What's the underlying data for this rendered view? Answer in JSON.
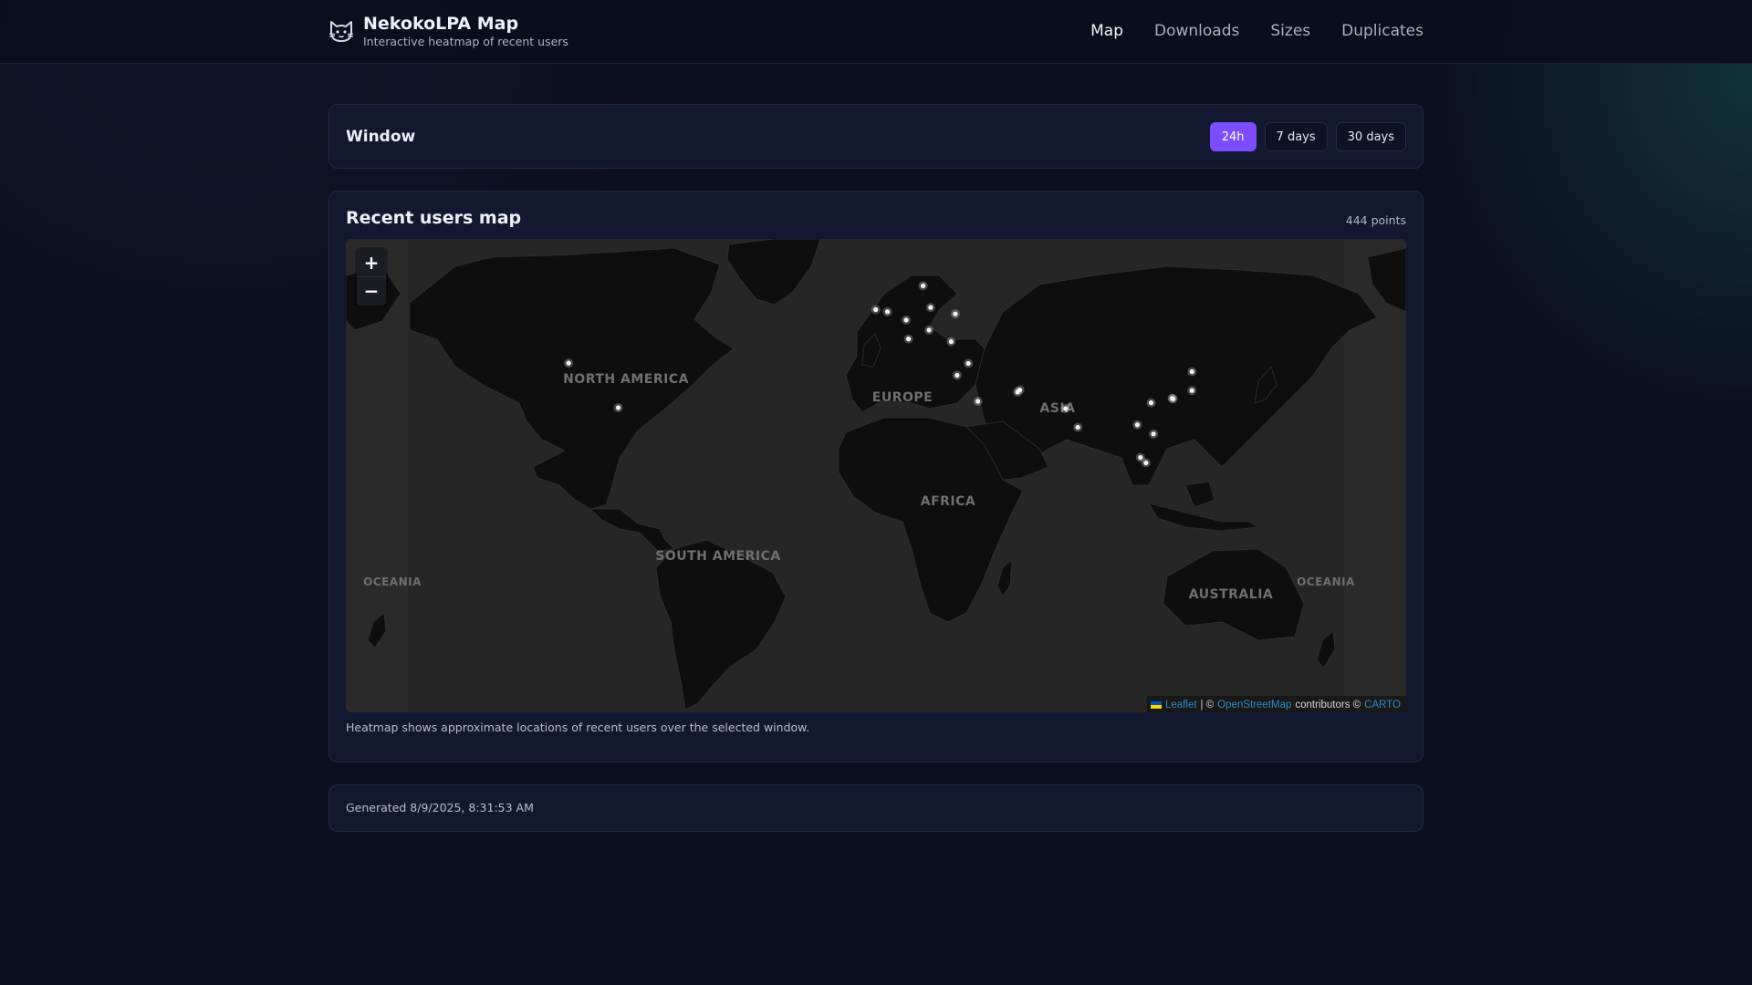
{
  "header": {
    "title": "NekokoLPA Map",
    "subtitle": "Interactive heatmap of recent users",
    "nav": [
      {
        "label": "Map",
        "active": true
      },
      {
        "label": "Downloads",
        "active": false
      },
      {
        "label": "Sizes",
        "active": false
      },
      {
        "label": "Duplicates",
        "active": false
      }
    ],
    "logo_icon": "cat-face-icon"
  },
  "window": {
    "title": "Window",
    "options": [
      "24h",
      "7 days",
      "30 days"
    ],
    "selected": "24h",
    "accent_color": "#7c4dff"
  },
  "map_card": {
    "title": "Recent users map",
    "points_label": "444 points",
    "zoom_in": "+",
    "zoom_out": "−",
    "note": "Heatmap shows approximate locations of recent users over the selected window.",
    "labels": [
      "NORTH AMERICA",
      "EUROPE",
      "ASIA",
      "AFRICA",
      "SOUTH AMERICA",
      "AUSTRALIA",
      "OCEANIA",
      "OCEANIA"
    ],
    "attribution": {
      "leaflet": "Leaflet",
      "sep": "| ©",
      "osm": "OpenStreetMap",
      "contributors": "contributors ©",
      "carto": "CARTO"
    },
    "heat_points": [
      {
        "lat": 59.3,
        "lon": 18.1
      },
      {
        "lat": 52.2,
        "lon": 21.0
      },
      {
        "lat": 50.1,
        "lon": 30.5
      },
      {
        "lat": 51.5,
        "lon": -0.1
      },
      {
        "lat": 50.8,
        "lon": 4.4
      },
      {
        "lat": 48.1,
        "lon": 11.6
      },
      {
        "lat": 41.9,
        "lon": 12.5
      },
      {
        "lat": 44.8,
        "lon": 20.4
      },
      {
        "lat": 41.0,
        "lon": 28.9
      },
      {
        "lat": 33.9,
        "lon": 35.5
      },
      {
        "lat": 30.0,
        "lon": 31.2
      },
      {
        "lat": 21.5,
        "lon": 39.2
      },
      {
        "lat": 25.2,
        "lon": 55.3
      },
      {
        "lat": 24.5,
        "lon": 54.4
      },
      {
        "lat": 19.1,
        "lon": 72.9
      },
      {
        "lat": 13.0,
        "lon": 77.6
      },
      {
        "lat": 13.8,
        "lon": 100.5
      },
      {
        "lat": 10.8,
        "lon": 106.7
      },
      {
        "lat": 21.0,
        "lon": 105.8
      },
      {
        "lat": 22.3,
        "lon": 114.2
      },
      {
        "lat": 22.5,
        "lon": 113.9
      },
      {
        "lat": 25.0,
        "lon": 121.5
      },
      {
        "lat": 31.2,
        "lon": 121.5
      },
      {
        "lat": 3.1,
        "lon": 101.7
      },
      {
        "lat": 1.35,
        "lon": 103.8
      },
      {
        "lat": 34.0,
        "lon": -118.2
      },
      {
        "lat": 19.4,
        "lon": -99.1
      }
    ]
  },
  "footer": {
    "generated": "Generated 8/9/2025, 8:31:53 AM"
  }
}
